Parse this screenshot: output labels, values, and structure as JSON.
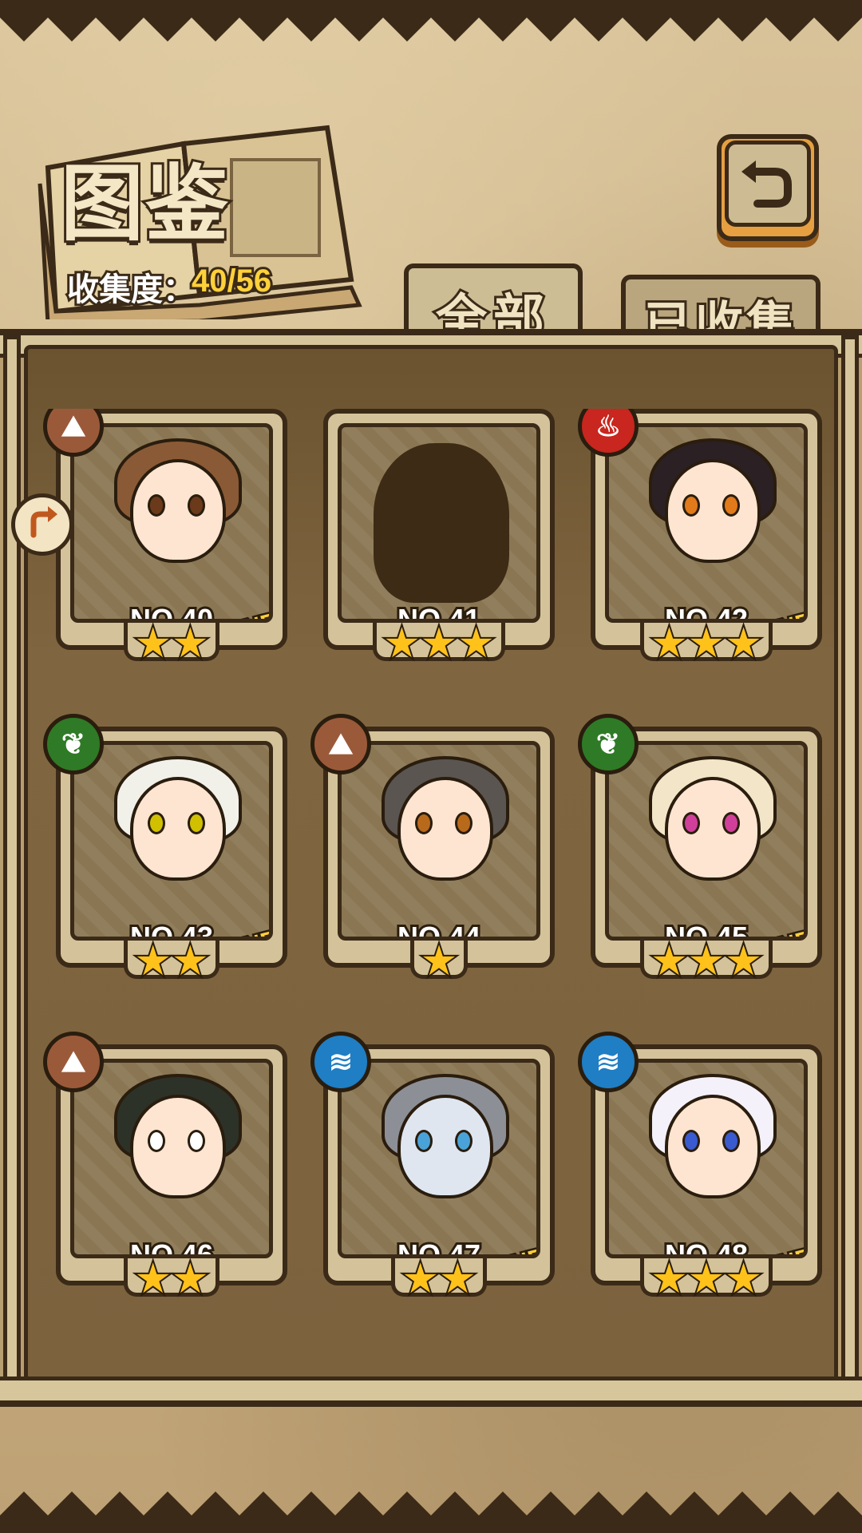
{
  "header": {
    "title": "图鉴",
    "collect_label": "收集度：",
    "collect_value": "40/56"
  },
  "tabs": [
    {
      "label": "全部",
      "active": true
    },
    {
      "label": "已收集",
      "active": false
    }
  ],
  "cards": [
    {
      "number": "NO.40",
      "stars": "★★",
      "new": "NEW",
      "element": "earth",
      "hair": "#8a5a36",
      "eye": "#6a3a1a"
    },
    {
      "number": "NO.41",
      "stars": "★★★",
      "new": "",
      "element": "",
      "hair": "",
      "eye": ""
    },
    {
      "number": "NO.42",
      "stars": "★★★",
      "new": "NEW",
      "element": "fire",
      "hair": "#2b2024",
      "eye": "#e07a1a"
    },
    {
      "number": "NO.43",
      "stars": "★★",
      "new": "NEW",
      "element": "grass",
      "hair": "#f1f1ea",
      "eye": "#d0c000"
    },
    {
      "number": "NO.44",
      "stars": "★",
      "new": "",
      "element": "earth",
      "hair": "#5a5550",
      "eye": "#b86a1a"
    },
    {
      "number": "NO.45",
      "stars": "★★★",
      "new": "NEW",
      "element": "grass",
      "hair": "#f3e6c8",
      "eye": "#d0409a"
    },
    {
      "number": "NO.46",
      "stars": "★★",
      "new": "",
      "element": "earth",
      "hair": "#2d3228",
      "eye": "#ffffff"
    },
    {
      "number": "NO.47",
      "stars": "★★",
      "new": "NEW",
      "element": "water",
      "hair": "#8d8f96",
      "eye": "#4aa3d8"
    },
    {
      "number": "NO.48",
      "stars": "★★★",
      "new": "NEW",
      "element": "water",
      "hair": "#f4f1fb",
      "eye": "#3a5ad0"
    }
  ],
  "icons": {
    "back": "back-arrow-icon",
    "side": "swap-icon"
  },
  "colors": {
    "accent": "#ffd13a",
    "outline": "#3b2a17",
    "star": "#ffc21a"
  }
}
